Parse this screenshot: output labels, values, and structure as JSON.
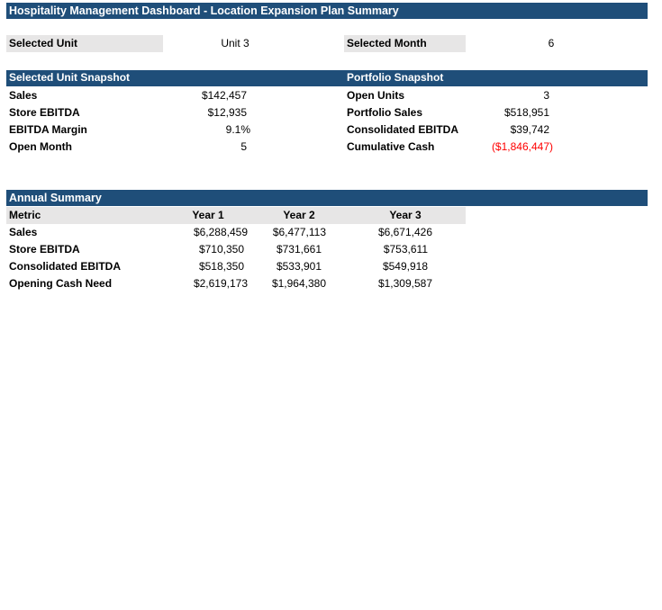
{
  "title": "Hospitality Management Dashboard - Location Expansion Plan Summary",
  "selectors": {
    "unit_label": "Selected Unit",
    "unit_value": "Unit 3",
    "month_label": "Selected Month",
    "month_value": "6"
  },
  "unit_snapshot": {
    "header": "Selected Unit Snapshot",
    "rows": [
      {
        "label": "Sales",
        "value": "$142,457"
      },
      {
        "label": "Store EBITDA",
        "value": "$12,935"
      },
      {
        "label": "EBITDA Margin",
        "value": "9.1%"
      },
      {
        "label": "Open Month",
        "value": "5"
      }
    ]
  },
  "portfolio_snapshot": {
    "header": "Portfolio Snapshot",
    "rows": [
      {
        "label": "Open Units",
        "value": "3"
      },
      {
        "label": "Portfolio Sales",
        "value": "$518,951"
      },
      {
        "label": "Consolidated EBITDA",
        "value": "$39,742"
      },
      {
        "label": "Cumulative Cash",
        "value": "($1,846,447)"
      }
    ],
    "negative_color": "#ff0000"
  },
  "annual_summary": {
    "header": "Annual Summary",
    "columns": [
      "Metric",
      "Year 1",
      "Year 2",
      "Year 3"
    ],
    "rows": [
      {
        "metric": "Sales",
        "y1": "$6,288,459",
        "y2": "$6,477,113",
        "y3": "$6,671,426"
      },
      {
        "metric": "Store EBITDA",
        "y1": "$710,350",
        "y2": "$731,661",
        "y3": "$753,611"
      },
      {
        "metric": "Consolidated EBITDA",
        "y1": "$518,350",
        "y2": "$533,901",
        "y3": "$549,918"
      },
      {
        "metric": "Opening Cash Need",
        "y1": "$2,619,173",
        "y2": "$1,964,380",
        "y3": "$1,309,587"
      }
    ]
  },
  "colors": {
    "header_bar": "#1f4e79",
    "label_fill": "#e7e6e6"
  }
}
